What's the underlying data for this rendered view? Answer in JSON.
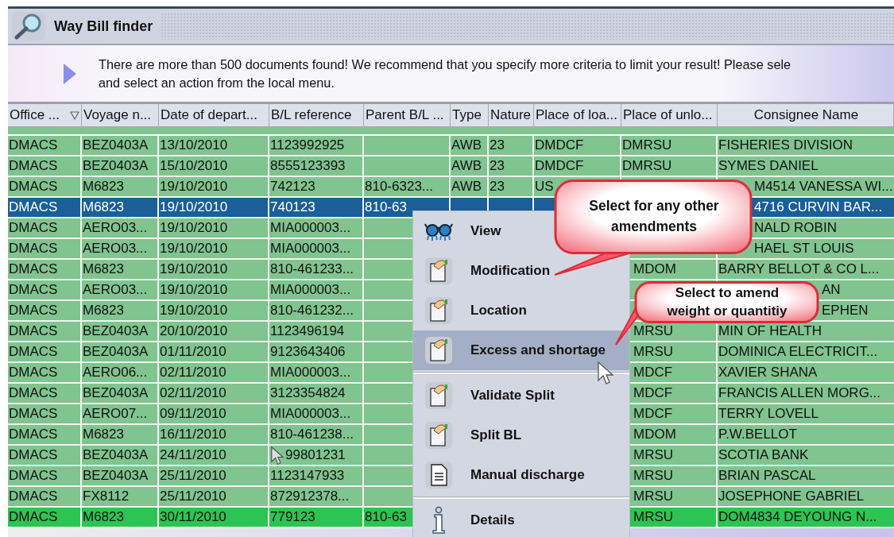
{
  "window": {
    "title": "Way Bill finder"
  },
  "banner": {
    "text": "There are more than 500 documents found! We recommend that you specify more criteria to limit your result! Please sele",
    "text_2": "and select an action from the local menu."
  },
  "table": {
    "columns": [
      {
        "label": "Office ...",
        "sorted": true
      },
      {
        "label": "Voyage n...",
        "sorted": false
      },
      {
        "label": "Date of depart...",
        "sorted": false
      },
      {
        "label": "B/L reference",
        "sorted": false
      },
      {
        "label": "Parent B/L ...",
        "sorted": false
      },
      {
        "label": "Type",
        "sorted": false
      },
      {
        "label": "Nature",
        "sorted": false
      },
      {
        "label": "Place of loa...",
        "sorted": false
      },
      {
        "label": "Place of unlo...",
        "sorted": false
      },
      {
        "label": "Consignee Name",
        "sorted": false
      }
    ],
    "rows": [
      {
        "selected": false,
        "color": "#80c48f",
        "cells": [
          "DMACS",
          "BEZ0403A",
          "13/10/2010",
          "1123992925",
          null,
          "AWB",
          "23",
          "DMDCF",
          "DMRSU",
          "FISHERIES DIVISION"
        ]
      },
      {
        "selected": false,
        "color": "#80c48f",
        "cells": [
          "DMACS",
          "BEZ0403A",
          "15/10/2010",
          "8555123393",
          null,
          "AWB",
          "23",
          "DMDCF",
          "DMRSU",
          "SYMES DANIEL"
        ]
      },
      {
        "selected": false,
        "color": "#80c48f",
        "cells": [
          "DMACS",
          "M6823",
          "19/10/2010",
          "742123",
          "810-6323...",
          "AWB",
          "23",
          "US",
          null,
          {
            "text": "M4514 VANESSA WI...",
            "clipped": true
          }
        ]
      },
      {
        "selected": true,
        "cells": [
          "DMACS",
          "M6823",
          "19/10/2010",
          "740123",
          "810-63",
          null,
          null,
          null,
          null,
          {
            "text": "4716 CURVIN BAR...",
            "clipped": true
          }
        ]
      },
      {
        "selected": false,
        "color": "#80c48f",
        "cells": [
          "DMACS",
          "AERO03...",
          "19/10/2010",
          "MIA000003...",
          null,
          null,
          null,
          null,
          null,
          {
            "text": "NALD ROBIN",
            "clipped": true
          }
        ]
      },
      {
        "selected": false,
        "color": "#80c48f",
        "cells": [
          "DMACS",
          "AERO03...",
          "19/10/2010",
          "MIA000003...",
          null,
          null,
          null,
          null,
          null,
          {
            "text": "HAEL ST LOUIS",
            "clipped": true
          }
        ]
      },
      {
        "selected": false,
        "color": "#80c48f",
        "cells": [
          "DMACS",
          "M6823",
          "19/10/2010",
          "810-461233...",
          null,
          null,
          null,
          null,
          {
            "text": "MDOM",
            "clipped": true
          },
          "BARRY BELLOT & CO L..."
        ]
      },
      {
        "selected": false,
        "color": "#80c48f",
        "cells": [
          "DMACS",
          "AERO03...",
          "19/10/2010",
          "MIA000003...",
          null,
          null,
          null,
          null,
          null,
          {
            "text": "AN",
            "clipped": true
          }
        ]
      },
      {
        "selected": false,
        "color": "#80c48f",
        "cells": [
          "DMACS",
          "M6823",
          "19/10/2010",
          "810-461232...",
          null,
          null,
          null,
          null,
          null,
          {
            "text": "EPHEN",
            "clipped": true
          }
        ]
      },
      {
        "selected": false,
        "color": "#80c48f",
        "cells": [
          "DMACS",
          "BEZ0403A",
          "20/10/2010",
          "1123496194",
          null,
          null,
          null,
          null,
          {
            "text": "MRSU",
            "clipped": true
          },
          "MIN OF HEALTH"
        ]
      },
      {
        "selected": false,
        "color": "#80c48f",
        "cells": [
          "DMACS",
          "BEZ0403A",
          "01/11/2010",
          "9123643406",
          null,
          null,
          null,
          null,
          {
            "text": "MRSU",
            "clipped": true
          },
          "DOMINICA ELECTRICIT..."
        ]
      },
      {
        "selected": false,
        "color": "#80c48f",
        "cells": [
          "DMACS",
          "AERO06...",
          "02/11/2010",
          "MIA000003...",
          null,
          null,
          null,
          null,
          {
            "text": "MDCF",
            "clipped": true
          },
          "XAVIER SHANA"
        ]
      },
      {
        "selected": false,
        "color": "#80c48f",
        "cells": [
          "DMACS",
          "BEZ0403A",
          "02/11/2010",
          "3123354824",
          null,
          null,
          null,
          null,
          {
            "text": "MDCF",
            "clipped": true
          },
          "FRANCIS ALLEN MORG..."
        ]
      },
      {
        "selected": false,
        "color": "#80c48f",
        "cells": [
          "DMACS",
          "AERO07...",
          "09/11/2010",
          "MIA000003...",
          null,
          null,
          null,
          null,
          {
            "text": "MDCF",
            "clipped": true
          },
          "TERRY LOVELL"
        ]
      },
      {
        "selected": false,
        "color": "#80c48f",
        "cells": [
          "DMACS",
          "M6823",
          "16/11/2010",
          "810-461238...",
          null,
          null,
          null,
          null,
          {
            "text": "MDOM",
            "clipped": true
          },
          "P.W.BELLOT"
        ]
      },
      {
        "selected": false,
        "color": "#80c48f",
        "cells": [
          "DMACS",
          "BEZ0403A",
          "24/11/2010",
          {
            "text": "99801231",
            "clipped": true
          },
          null,
          null,
          null,
          null,
          {
            "text": "MRSU",
            "clipped": true
          },
          "SCOTIA BANK"
        ]
      },
      {
        "selected": false,
        "color": "#80c48f",
        "cells": [
          "DMACS",
          "BEZ0403A",
          "25/11/2010",
          "1123147933",
          null,
          null,
          null,
          null,
          {
            "text": "MRSU",
            "clipped": true
          },
          "BRIAN PASCAL"
        ]
      },
      {
        "selected": false,
        "color": "#80c48f",
        "cells": [
          "DMACS",
          "FX8112",
          "25/11/2010",
          "872912378...",
          null,
          null,
          null,
          null,
          {
            "text": "MRSU",
            "clipped": true
          },
          "JOSEPHONE GABRIEL"
        ]
      },
      {
        "selected": false,
        "color": "#2cc452",
        "cells": [
          "DMACS",
          "M6823",
          "30/11/2010",
          "779123",
          "810-63",
          null,
          null,
          null,
          {
            "text": "MRSU",
            "clipped": true
          },
          "DOM4834 DEYOUNG N..."
        ]
      }
    ]
  },
  "context_menu": {
    "items": [
      {
        "label": "View",
        "kind": "view",
        "selected": false,
        "separator_before": false
      },
      {
        "label": "Modification",
        "kind": "edit",
        "selected": false,
        "separator_before": false
      },
      {
        "label": "Location",
        "kind": "edit",
        "selected": false,
        "separator_before": false
      },
      {
        "label": "Excess and shortage",
        "kind": "edit",
        "selected": true,
        "separator_before": false
      },
      {
        "label": "Validate Split",
        "kind": "edit",
        "selected": false,
        "separator_before": true
      },
      {
        "label": "Split BL",
        "kind": "edit",
        "selected": false,
        "separator_before": false
      },
      {
        "label": "Manual discharge",
        "kind": "document",
        "selected": false,
        "separator_before": false
      },
      {
        "label": "Details",
        "kind": "info",
        "selected": false,
        "separator_before": true
      }
    ]
  },
  "callouts": [
    {
      "text": "Select for any other amendments"
    },
    {
      "text": "Select to amend weight or quantitiy"
    }
  ]
}
